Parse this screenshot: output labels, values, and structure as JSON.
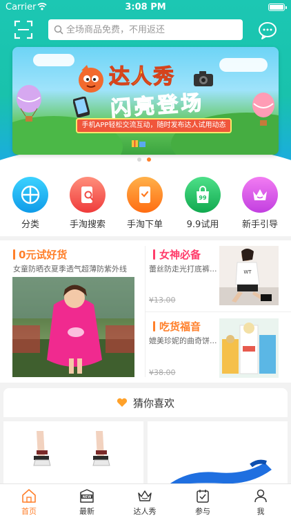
{
  "status_bar": {
    "carrier": "Carrier",
    "time": "3:08 PM"
  },
  "search": {
    "placeholder": "全场商品免费，不用返还"
  },
  "banner": {
    "title": "达人秀",
    "subtitle": "闪亮登场",
    "ribbon": "手机APP轻松交流互动，随时发布达人试用动态",
    "slides": 2,
    "active_slide": 2
  },
  "categories": [
    {
      "label": "分类",
      "icon": "grid-icon",
      "color": "#19b4f0"
    },
    {
      "label": "手淘搜索",
      "icon": "phone-search-icon",
      "color": "#f4584f"
    },
    {
      "label": "手淘下单",
      "icon": "phone-order-icon",
      "color": "#ff8a1a"
    },
    {
      "label": "9.9试用",
      "icon": "shopping-bag-icon",
      "color": "#1fbf62"
    },
    {
      "label": "新手引导",
      "icon": "crown-icon",
      "color": "#d94fe8"
    }
  ],
  "promo": {
    "free": {
      "title": "0元试好货",
      "desc": "女童防晒衣夏季透气超薄防紫外线",
      "color": "#ff7f2a"
    },
    "goddess": {
      "title": "女神必备",
      "desc": "蕾丝防走光打底裤...",
      "price": "¥13.00",
      "color": "#ff3d6b"
    },
    "foodie": {
      "title": "吃货福音",
      "desc": "媲美珍妮的曲奇饼...",
      "price": "¥38.00",
      "color": "#ff7f2a"
    }
  },
  "guess": {
    "title": "猜你喜欢"
  },
  "tabs": [
    {
      "label": "首页",
      "icon": "home-icon",
      "active": true
    },
    {
      "label": "最新",
      "icon": "new-badge-icon",
      "active": false
    },
    {
      "label": "达人秀",
      "icon": "crown-outline-icon",
      "active": false
    },
    {
      "label": "参与",
      "icon": "calendar-check-icon",
      "active": false
    },
    {
      "label": "我",
      "icon": "user-icon",
      "active": false
    }
  ],
  "colors": {
    "accent": "#ff7f2a",
    "header": "#1cc7b3"
  }
}
